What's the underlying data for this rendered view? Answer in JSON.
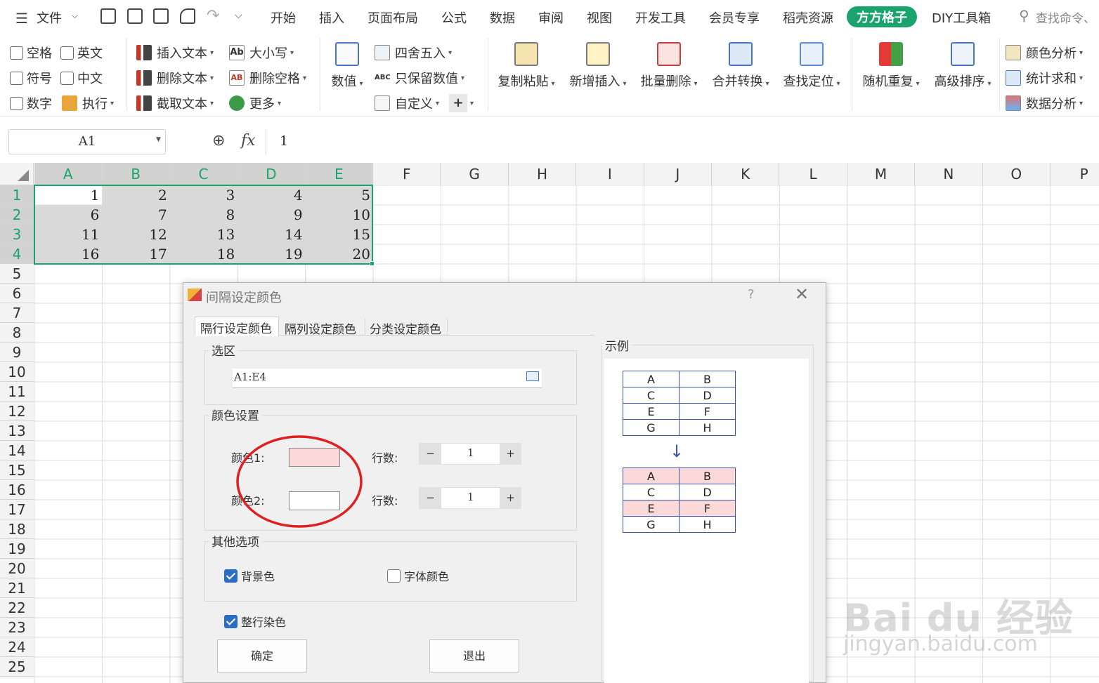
{
  "menu": {
    "file": "文件",
    "tabs": [
      "开始",
      "插入",
      "页面布局",
      "公式",
      "数据",
      "审阅",
      "视图",
      "开发工具",
      "会员专享",
      "稻壳资源",
      "方方格子",
      "DIY工具箱"
    ],
    "active_tab": "方方格子",
    "search": "查找命令、"
  },
  "ribbon": {
    "checks": [
      "空格",
      "英文",
      "符号",
      "中文",
      "数字"
    ],
    "execute": "执行",
    "text_tools": [
      "插入文本",
      "删除文本",
      "截取文本"
    ],
    "case_tools": [
      "大小写",
      "删除空格",
      "更多"
    ],
    "numeric": "数值",
    "round_tools": [
      "四舍五入",
      "只保留数值",
      "自定义"
    ],
    "big_buttons": [
      "复制粘贴",
      "新增插入",
      "批量删除",
      "合并转换",
      "查找定位",
      "随机重复",
      "高级排序"
    ],
    "analysis": [
      "颜色分析",
      "统计求和",
      "数据分析"
    ]
  },
  "formula_bar": {
    "name_box": "A1",
    "fx": "fx",
    "value": "1"
  },
  "grid": {
    "columns": [
      "A",
      "B",
      "C",
      "D",
      "E",
      "F",
      "G",
      "H",
      "I",
      "J",
      "K",
      "L",
      "M",
      "N",
      "O",
      "P"
    ],
    "rows": [
      "1",
      "2",
      "3",
      "4",
      "5",
      "6",
      "7",
      "8",
      "9",
      "10",
      "11",
      "12",
      "13",
      "14",
      "15",
      "16",
      "17",
      "18",
      "19",
      "20",
      "21",
      "22",
      "23",
      "24",
      "25"
    ],
    "data": [
      [
        "1",
        "2",
        "3",
        "4",
        "5"
      ],
      [
        "6",
        "7",
        "8",
        "9",
        "10"
      ],
      [
        "11",
        "12",
        "13",
        "14",
        "15"
      ],
      [
        "16",
        "17",
        "18",
        "19",
        "20"
      ]
    ]
  },
  "dialog": {
    "title": "间隔设定颜色",
    "help": "?",
    "tabs": [
      "隔行设定颜色",
      "隔列设定颜色",
      "分类设定颜色"
    ],
    "selection_group": "选区",
    "selection_value": "A1:E4",
    "color_group": "颜色设置",
    "color1_label": "颜色1:",
    "color2_label": "颜色2:",
    "rows_label": "行数:",
    "color1_rows": "1",
    "color2_rows": "1",
    "color1": "#fcd9d9",
    "color2": "#ffffff",
    "minus": "−",
    "plus": "+",
    "other_group": "其他选项",
    "bg_color": "背景色",
    "bg_checked": true,
    "font_color": "字体颜色",
    "font_checked": false,
    "whole_row": "整行染色",
    "whole_row_checked": true,
    "ok": "确定",
    "exit": "退出",
    "example_group": "示例",
    "example_before": [
      [
        "A",
        "B"
      ],
      [
        "C",
        "D"
      ],
      [
        "E",
        "F"
      ],
      [
        "G",
        "H"
      ]
    ],
    "example_after": [
      [
        "A",
        "B"
      ],
      [
        "C",
        "D"
      ],
      [
        "E",
        "F"
      ],
      [
        "G",
        "H"
      ]
    ],
    "arrow": "↓"
  },
  "watermark": {
    "brand": "Bai du 经验",
    "url": "jingyan.baidu.com"
  },
  "colors": {
    "accent": "#1aa36f",
    "selection_fill": "#d9d9d9",
    "highlight_circle": "#e02020",
    "checkbox": "#2b6cc4"
  }
}
